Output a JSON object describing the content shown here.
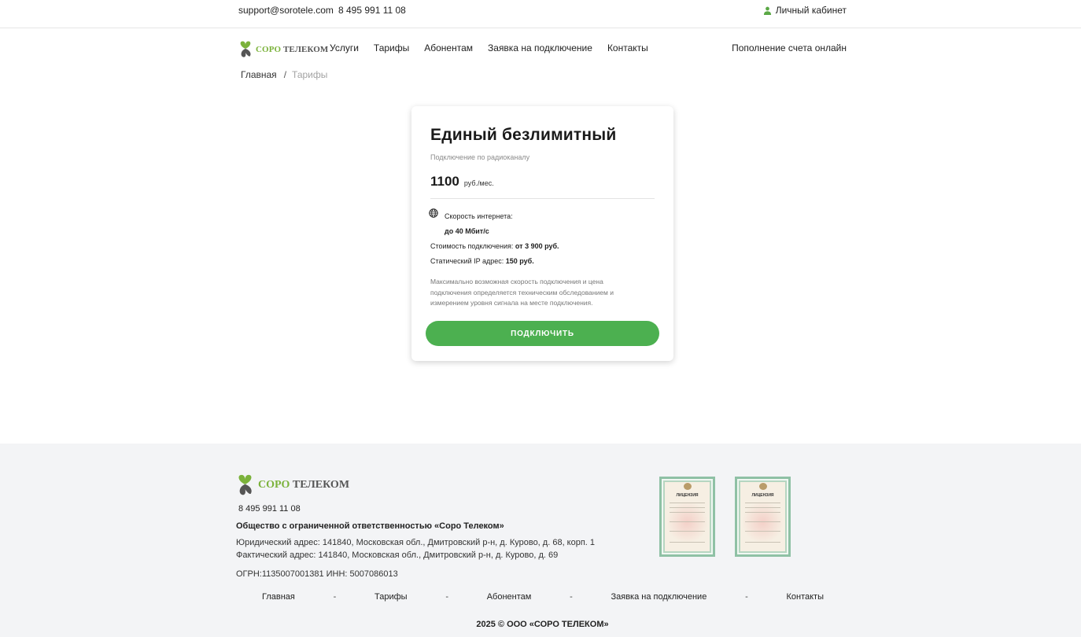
{
  "topbar": {
    "email": "support@sorotele.com",
    "phone": "8 495 991 11 08",
    "cabinet_label": "Личный кабинет"
  },
  "brand": {
    "name_green": "СОРО",
    "name_dark": "ТЕЛЕКОМ",
    "green_color": "#7bb23b"
  },
  "nav": {
    "items": [
      "Услуги",
      "Тарифы",
      "Абонентам",
      "Заявка на подключение",
      "Контакты"
    ],
    "topup_label": "Пополнение счета онлайн"
  },
  "breadcrumb": {
    "home": "Главная",
    "separator": "/",
    "current": "Тарифы"
  },
  "tariff": {
    "title": "Единый безлимитный",
    "subtitle": "Подключение по радиоканалу",
    "price": "1100",
    "price_unit": "руб./мес.",
    "speed_label": "Скорость интернета:",
    "speed_value": "до 40 Мбит/с",
    "connection_label": "Стоимость подключения: ",
    "connection_value": "от 3 900 руб.",
    "ip_label": "Статический IP адрес: ",
    "ip_value": "150 руб.",
    "note": "Максимально возможная скорость подключения и цена подключения определяется техническим обследованием и измерением уровня сигнала на месте подключения.",
    "button_label": "ПОДКЛЮЧИТЬ",
    "button_color": "#4cb050"
  },
  "footer": {
    "phone": "8 495 991 11 08",
    "company": "Общество с ограниченной ответственностью «Соро Телеком»",
    "legal_address": "Юридический адрес: 141840, Московская обл., Дмитровский р-н, д. Курово, д. 68, корп. 1",
    "actual_address": "Фактический адрес: 141840, Московская обл., Дмитровский р-н, д. Курово, д. 69",
    "ogrn": "ОГРН:1135007001381 ИНН: 5007086013",
    "license_title": "ЛИЦЕНЗИЯ",
    "menu": [
      "Главная",
      "Тарифы",
      "Абонентам",
      "Заявка на подключение",
      "Контакты"
    ],
    "menu_separator": "-",
    "copyright": "2025 © ООО «СОРО ТЕЛЕКОМ»"
  }
}
